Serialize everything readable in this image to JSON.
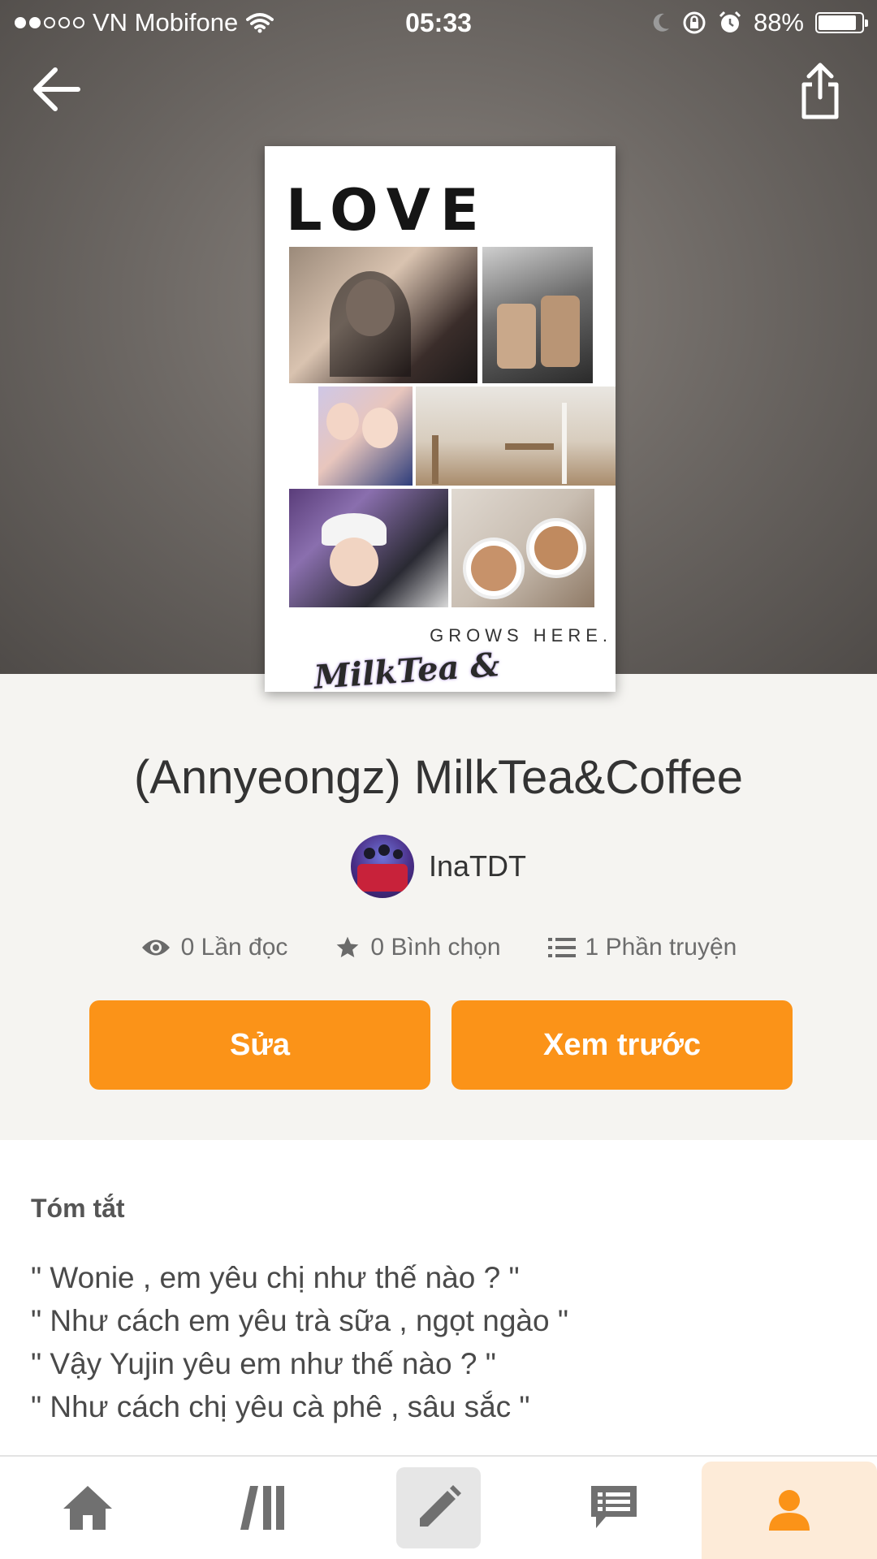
{
  "status_bar": {
    "carrier": "VN Mobifone",
    "time": "05:33",
    "battery": "88%",
    "battery_level": 0.88,
    "signal_bars_filled": 2,
    "signal_bars_total": 5
  },
  "header": {
    "back_icon": "arrow-left-icon",
    "share_icon": "share-icon"
  },
  "cover": {
    "headline": "LOVE",
    "tagline": "GROWS HERE.",
    "script_title": "MilkTea & Coffee"
  },
  "story": {
    "title": "(Annyeongz) MilkTea&Coffee",
    "author": "InaTDT"
  },
  "stats": {
    "reads": "0 Lần đọc",
    "votes": "0 Bình chọn",
    "parts": "1 Phần truyện"
  },
  "actions": {
    "edit": "Sửa",
    "preview": "Xem trước"
  },
  "summary": {
    "title": "Tóm tắt",
    "lines": [
      "\" Wonie , em yêu chị như thế nào ? \"",
      "\" Như cách em yêu trà sữa , ngọt ngào \"",
      "\" Vậy Yujin yêu em như thế nào ? \"",
      "\" Như cách chị yêu cà phê , sâu sắc \""
    ]
  },
  "nav": {
    "items": [
      "home-icon",
      "library-icon",
      "write-icon",
      "messages-icon",
      "profile-icon"
    ],
    "active": "profile-icon"
  },
  "colors": {
    "accent": "#fb9318",
    "active_tab_bg": "#fdebd8",
    "nav_icon": "#707070"
  }
}
